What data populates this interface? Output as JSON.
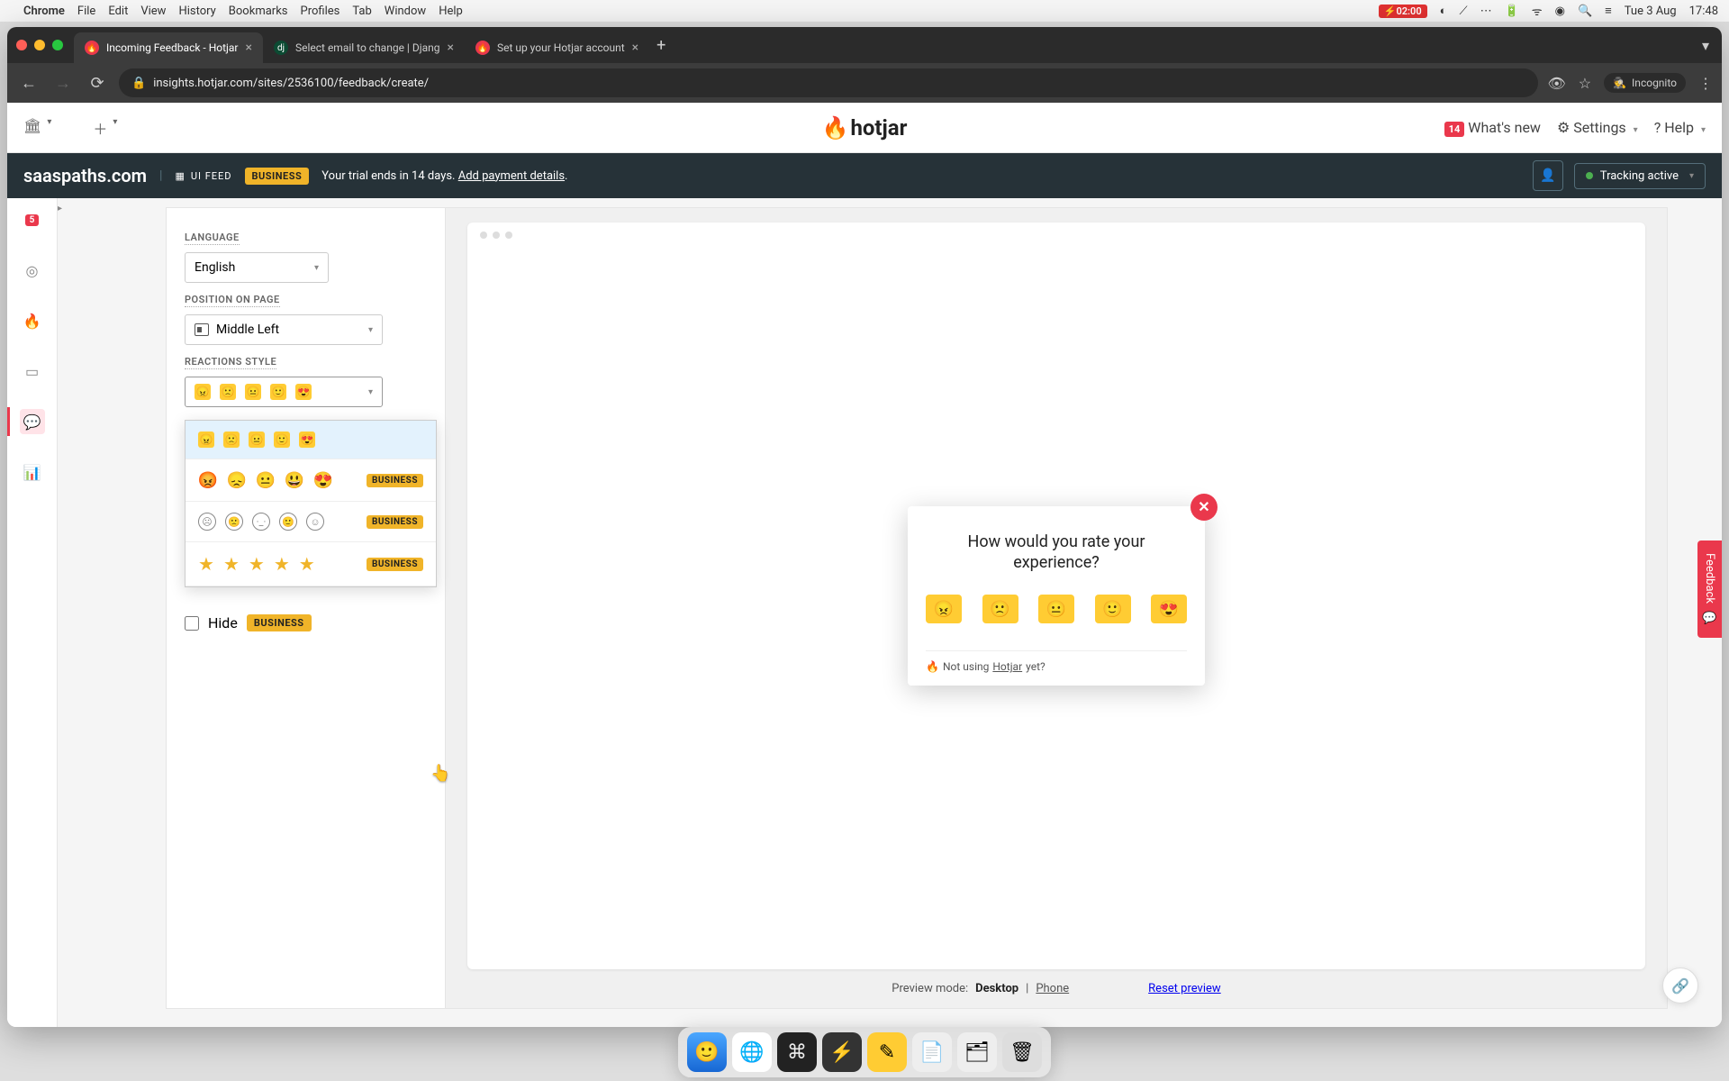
{
  "mac_menu": {
    "app": "Chrome",
    "items": [
      "File",
      "Edit",
      "View",
      "History",
      "Bookmarks",
      "Profiles",
      "Tab",
      "Window",
      "Help"
    ],
    "battery": "02:00",
    "date": "Tue 3 Aug",
    "time": "17:48"
  },
  "tabs": [
    {
      "title": "Incoming Feedback - Hotjar",
      "active": true
    },
    {
      "title": "Select email to change | Djang",
      "active": false
    },
    {
      "title": "Set up your Hotjar account",
      "active": false
    }
  ],
  "url": "insights.hotjar.com/sites/2536100/feedback/create/",
  "incognito": "Incognito",
  "hj_header": {
    "whats_new_count": "14",
    "whats_new": "What's new",
    "settings": "Settings",
    "help": "Help"
  },
  "subheader": {
    "site": "saaspaths.com",
    "ui_feed": "UI FEED",
    "plan_badge": "BUSINESS",
    "trial_text": "Your trial ends in 14 days.",
    "trial_link": "Add payment details",
    "tracking": "Tracking active"
  },
  "rail": {
    "badge": "5"
  },
  "config": {
    "language_label": "LANGUAGE",
    "language_value": "English",
    "position_label": "POSITION ON PAGE",
    "position_value": "Middle Left",
    "reactions_label": "REACTIONS STYLE",
    "hide_label": "Hide",
    "business_badge": "BUSINESS"
  },
  "dropdown": {
    "options": [
      {
        "type": "yellow",
        "locked": false
      },
      {
        "type": "native",
        "locked": true
      },
      {
        "type": "outline",
        "locked": true
      },
      {
        "type": "stars",
        "locked": true
      }
    ]
  },
  "preview": {
    "widget_title": "How would you rate your experience?",
    "footer_prefix": "Not using",
    "footer_brand": "Hotjar",
    "footer_suffix": "yet?",
    "mode_label": "Preview mode:",
    "mode_desktop": "Desktop",
    "mode_phone": "Phone",
    "reset": "Reset preview"
  },
  "feedback_tab": "Feedback"
}
